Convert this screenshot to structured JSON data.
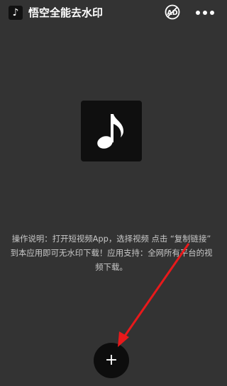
{
  "header": {
    "app_icon_glyph": "♪",
    "title": "悟空全能去水印",
    "ad_icon": "no-ads-icon",
    "more_icon": "more-dots-icon"
  },
  "main": {
    "music_icon": "music-note-icon",
    "instructions": "操作说明：打开短视频App，选择视频 点击 “复制链接” 到本应用即可无水印下载！应用支持：全网所有平台的视频下载。",
    "add_button_label": "+"
  },
  "annotation": {
    "arrow_color": "#e8191b"
  }
}
